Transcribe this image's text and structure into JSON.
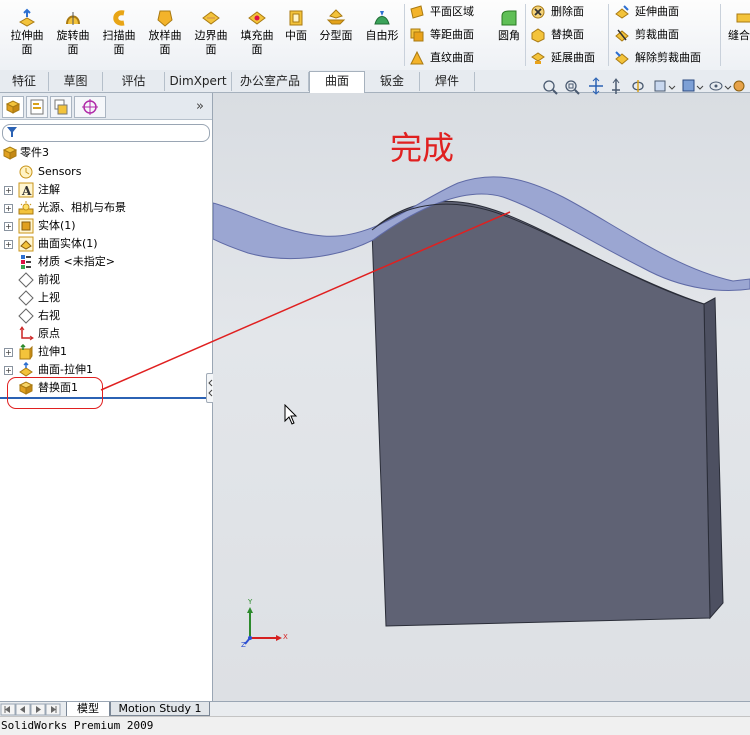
{
  "ribbon": {
    "big_buttons": [
      {
        "label": "拉伸曲\n面",
        "icon": "extruded-surface-icon"
      },
      {
        "label": "旋转曲\n面",
        "icon": "revolved-surface-icon"
      },
      {
        "label": "扫描曲\n面",
        "icon": "swept-surface-icon"
      },
      {
        "label": "放样曲\n面",
        "icon": "lofted-surface-icon"
      },
      {
        "label": "边界曲\n面",
        "icon": "boundary-surface-icon"
      },
      {
        "label": "填充曲\n面",
        "icon": "filled-surface-icon"
      },
      {
        "label": "中面",
        "icon": "mid-surface-icon"
      },
      {
        "label": "分型面",
        "icon": "parting-surface-icon"
      },
      {
        "label": "自由形",
        "icon": "freeform-icon"
      }
    ],
    "col1": [
      {
        "label": "平面区域",
        "icon": "planar-surface-icon"
      },
      {
        "label": "等距曲面",
        "icon": "offset-surface-icon"
      },
      {
        "label": "直纹曲面",
        "icon": "ruled-surface-icon"
      }
    ],
    "fillet": {
      "label": "圆角",
      "icon": "fillet-icon"
    },
    "col2": [
      {
        "label": "删除面",
        "icon": "delete-face-icon"
      },
      {
        "label": "替换面",
        "icon": "replace-face-icon"
      },
      {
        "label": "延展曲面",
        "icon": "radiate-surface-icon"
      }
    ],
    "col3": [
      {
        "label": "延伸曲面",
        "icon": "extend-surface-icon"
      },
      {
        "label": "剪裁曲面",
        "icon": "trim-surface-icon"
      },
      {
        "label": "解除剪裁曲面",
        "icon": "untrim-surface-icon"
      }
    ],
    "knit": {
      "label": "缝合",
      "icon": "knit-surface-icon"
    }
  },
  "tabs": [
    {
      "label": "特征",
      "active": false
    },
    {
      "label": "草图",
      "active": false
    },
    {
      "label": "评估",
      "active": false
    },
    {
      "label": "DimXpert",
      "active": false
    },
    {
      "label": "办公室产品",
      "active": false
    },
    {
      "label": "曲面",
      "active": true
    },
    {
      "label": "钣金",
      "active": false
    },
    {
      "label": "焊件",
      "active": false
    }
  ],
  "tree": {
    "root": "零件3",
    "items": [
      {
        "label": "Sensors",
        "expandable": false,
        "icon": "sensors-icon"
      },
      {
        "label": "注解",
        "expandable": true,
        "icon": "annotations-icon"
      },
      {
        "label": "光源、相机与布景",
        "expandable": true,
        "icon": "lights-cameras-icon"
      },
      {
        "label": "实体(1)",
        "expandable": true,
        "icon": "solid-bodies-icon"
      },
      {
        "label": "曲面实体(1)",
        "expandable": true,
        "icon": "surface-bodies-icon"
      },
      {
        "label": "材质 <未指定>",
        "expandable": false,
        "icon": "material-icon"
      },
      {
        "label": "前视",
        "expandable": false,
        "icon": "plane-icon"
      },
      {
        "label": "上视",
        "expandable": false,
        "icon": "plane-icon"
      },
      {
        "label": "右视",
        "expandable": false,
        "icon": "plane-icon"
      },
      {
        "label": "原点",
        "expandable": false,
        "icon": "origin-icon"
      },
      {
        "label": "拉伸1",
        "expandable": true,
        "icon": "extrude-feature-icon"
      },
      {
        "label": "曲面-拉伸1",
        "expandable": true,
        "icon": "surface-extrude-feature-icon"
      },
      {
        "label": "替换面1",
        "expandable": false,
        "icon": "replace-face-feature-icon"
      }
    ]
  },
  "viewport": {
    "annotation": "完成",
    "triad": {
      "x": "X",
      "y": "Y",
      "z": "Z"
    }
  },
  "bottom_tabs": [
    {
      "label": "模型",
      "active": true
    },
    {
      "label": "Motion Study 1",
      "active": false
    }
  ],
  "status": "SolidWorks Premium 2009",
  "colors": {
    "annotation_red": "#e02020",
    "body_face": "#5f6274",
    "surface_face": "#9ba6d2",
    "accent": "#2b62b4"
  }
}
